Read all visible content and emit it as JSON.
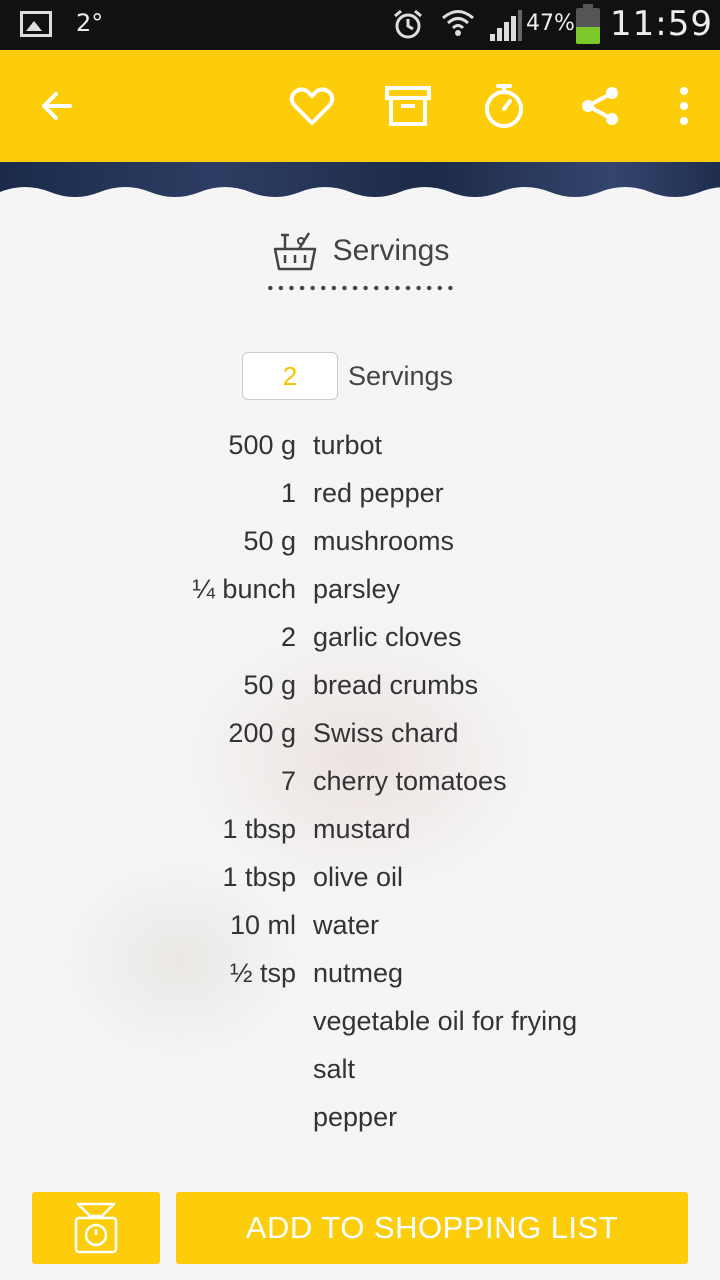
{
  "status_bar": {
    "temperature": "2°",
    "battery_percent": "47%",
    "battery_level": 0.47,
    "time": "11:59"
  },
  "app_bar": {
    "icons": [
      "back-arrow-icon",
      "heart-icon",
      "archive-box-icon",
      "timer-icon",
      "share-icon",
      "more-vert-icon"
    ]
  },
  "colors": {
    "accent": "#fdcd0b",
    "servings_value": "#f5c400",
    "text": "#333333"
  },
  "servings_section": {
    "title": "Servings",
    "icon": "basket-icon",
    "count": "2",
    "count_label": "Servings"
  },
  "ingredients": [
    {
      "qty": "500 g",
      "name": "turbot"
    },
    {
      "qty": "1",
      "name": "red pepper"
    },
    {
      "qty": "50 g",
      "name": "mushrooms"
    },
    {
      "qty": "¼ bunch",
      "name": "parsley"
    },
    {
      "qty": "2",
      "name": "garlic cloves"
    },
    {
      "qty": "50 g",
      "name": "bread crumbs"
    },
    {
      "qty": "200 g",
      "name": "Swiss chard"
    },
    {
      "qty": "7",
      "name": "cherry tomatoes"
    },
    {
      "qty": "1 tbsp",
      "name": "mustard"
    },
    {
      "qty": "1 tbsp",
      "name": "olive oil"
    },
    {
      "qty": "10 ml",
      "name": "water"
    },
    {
      "qty": "½ tsp",
      "name": "nutmeg"
    },
    {
      "qty": "",
      "name": "vegetable oil for frying"
    },
    {
      "qty": "",
      "name": "salt"
    },
    {
      "qty": "",
      "name": "pepper"
    }
  ],
  "bottom": {
    "scale_icon": "kitchen-scale-icon",
    "add_label": "ADD TO SHOPPING LIST"
  }
}
